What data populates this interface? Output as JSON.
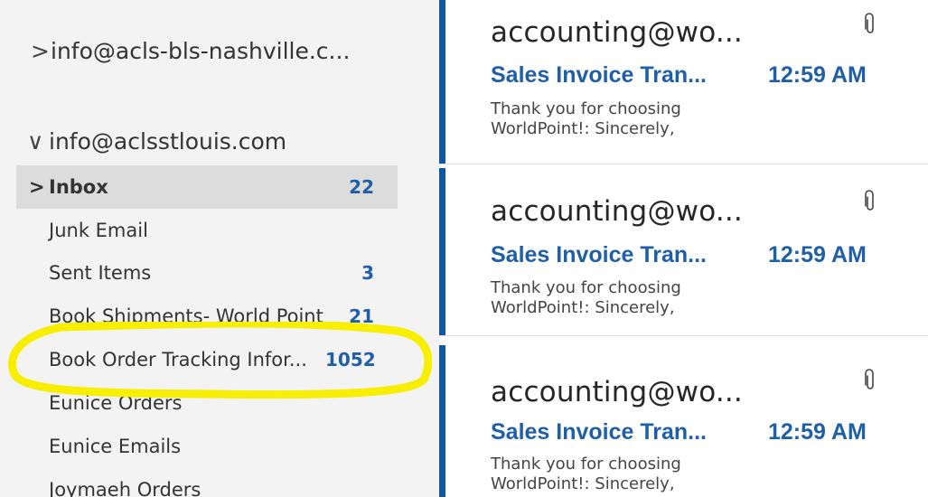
{
  "folder_pane": {
    "accounts": [
      {
        "chevron": ">",
        "label": "info@acls-bls-nashville.c..."
      },
      {
        "chevron": "∨",
        "label": "info@aclsstlouis.com"
      }
    ],
    "folders": [
      {
        "chevron": ">",
        "label": "Inbox",
        "count": "22"
      },
      {
        "chevron": "",
        "label": "Junk Email",
        "count": ""
      },
      {
        "chevron": "",
        "label": "Sent Items",
        "count": "3"
      },
      {
        "chevron": "",
        "label": "Book Shipments- World Point",
        "count": "21"
      },
      {
        "chevron": "",
        "label": "Book Order Tracking Infor...",
        "count": "1052"
      },
      {
        "chevron": "",
        "label": "Eunice Orders",
        "count": ""
      },
      {
        "chevron": "",
        "label": "Eunice Emails",
        "count": ""
      },
      {
        "chevron": "",
        "label": "Joymaeh Orders",
        "count": ""
      }
    ],
    "highlight_color": "#f7ee00"
  },
  "message_list": {
    "messages": [
      {
        "sender": "accounting@wo...",
        "subject": "Sales Invoice Tran...",
        "time": "12:59 AM",
        "preview_line1": "Thank you for choosing",
        "preview_line2": "WorldPoint!:  Sincerely,",
        "icon": "paperclip-icon"
      },
      {
        "sender": "accounting@wo...",
        "subject": "Sales Invoice Tran...",
        "time": "12:59 AM",
        "preview_line1": "Thank you for choosing",
        "preview_line2": "WorldPoint!:  Sincerely,",
        "icon": "paperclip-icon"
      },
      {
        "sender": "accounting@wo...",
        "subject": "Sales Invoice Tran...",
        "time": "12:59 AM",
        "preview_line1": "Thank you for choosing",
        "preview_line2": "WorldPoint!:  Sincerely,",
        "icon": "paperclip-icon"
      }
    ],
    "accent_color": "#1155a3",
    "subject_color": "#1f5fa8"
  }
}
